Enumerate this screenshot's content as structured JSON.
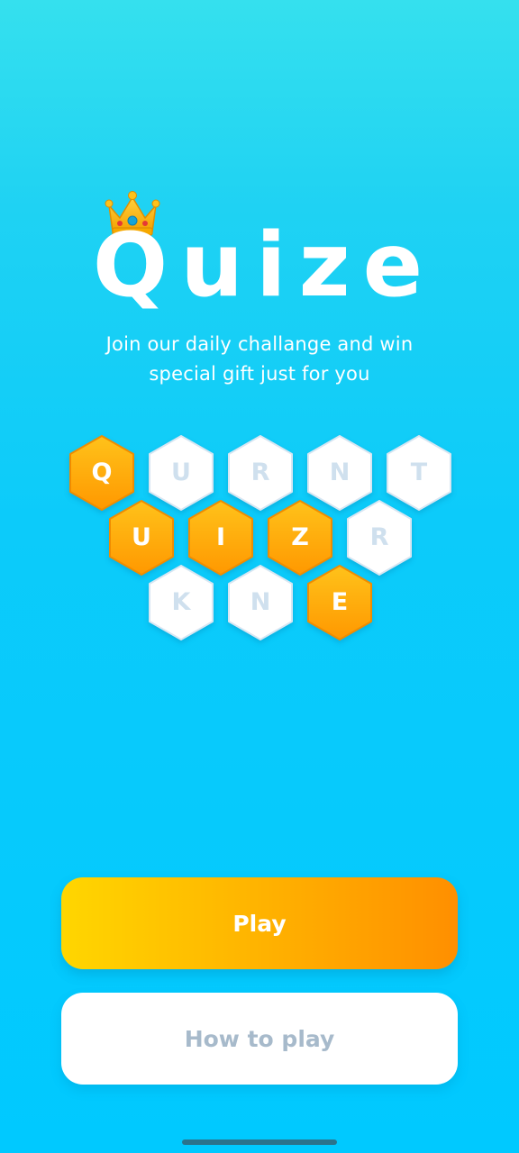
{
  "title": "Quize",
  "subtitle": {
    "line1": "Join our daily challange and win",
    "line2": "special gift just for you"
  },
  "crown_icon": "crown-icon",
  "colors": {
    "orange_light": "#FFC21A",
    "orange_dark": "#FF9800",
    "tile_white": "#FFFFFF",
    "tile_letter_muted": "#CFE0EE",
    "play_start": "#FFD600",
    "play_end": "#FF8F00",
    "how_text": "#A7BACB"
  },
  "tiles": {
    "row1": [
      {
        "letter": "Q",
        "highlighted": true
      },
      {
        "letter": "U",
        "highlighted": false
      },
      {
        "letter": "R",
        "highlighted": false
      },
      {
        "letter": "N",
        "highlighted": false
      },
      {
        "letter": "T",
        "highlighted": false
      }
    ],
    "row2": [
      {
        "letter": "U",
        "highlighted": true
      },
      {
        "letter": "I",
        "highlighted": true
      },
      {
        "letter": "Z",
        "highlighted": true
      },
      {
        "letter": "R",
        "highlighted": false
      }
    ],
    "row3": [
      {
        "letter": "K",
        "highlighted": false
      },
      {
        "letter": "N",
        "highlighted": false
      },
      {
        "letter": "E",
        "highlighted": true
      }
    ]
  },
  "buttons": {
    "play": "Play",
    "how_to_play": "How to play"
  }
}
